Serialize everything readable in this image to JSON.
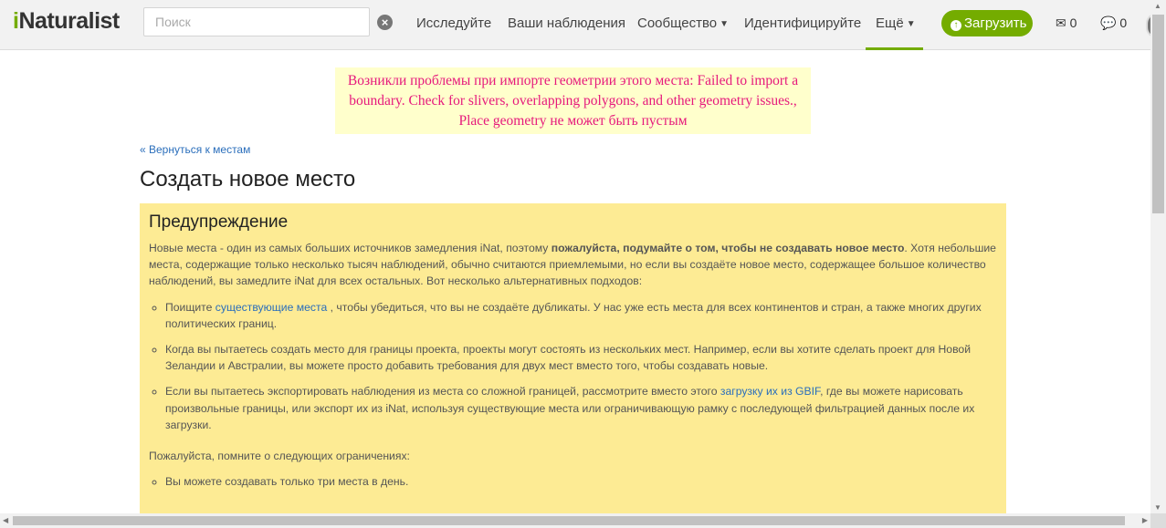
{
  "header": {
    "logo_prefix": "i",
    "logo_rest": "Naturalist",
    "search_placeholder": "Поиск",
    "clear_symbol": "×",
    "nav": {
      "explore": "Исследуйте",
      "your_observations": "Ваши наблюдения",
      "community": "Сообщество",
      "identify": "Идентифицируйте",
      "more": "Ещё"
    },
    "upload_label": "Загрузить",
    "messages_count": "0",
    "notifications_count": "0"
  },
  "error_notice": "Возникли проблемы при импорте геометрии этого места: Failed to import a boundary. Check for slivers, overlapping polygons, and other geometry issues., Place geometry не может быть пустым",
  "back_link": "« Вернуться к местам",
  "page_title": "Создать новое место",
  "warning": {
    "heading": "Предупреждение",
    "intro_1": "Новые места - один из самых больших источников замедления iNat, поэтому ",
    "intro_bold": "пожалуйста, подумайте о том, чтобы не создавать новое место",
    "intro_2": ". Хотя небольшие места, содержащие только несколько тысяч наблюдений, обычно считаются приемлемыми, но если вы создаёте новое место, содержащее большое количество наблюдений, вы замедлите iNat для всех остальных. Вот несколько альтернативных подходов:",
    "alt1_pre": "Поищите ",
    "alt1_link": "существующие места",
    "alt1_post": " , чтобы убедиться, что вы не создаёте дубликаты. У нас уже есть места для всех континентов и стран, а также многих других политических границ.",
    "alt2": "Когда вы пытаетесь создать место для границы проекта, проекты могут состоять из нескольких мест. Например, если вы хотите сделать проект для Новой Зеландии и Австралии, вы можете просто добавить требования для двух мест вместо того, чтобы создавать новые.",
    "alt3_pre": "Если вы пытаетесь экспортировать наблюдения из места со сложной границей, рассмотрите вместо этого ",
    "alt3_link": "загрузку их из GBIF",
    "alt3_post": ", где вы можете нарисовать произвольные границы, или экспорт их из iNat, используя существующие места или ограничивающую рамку с последующей фильтрацией данных после их загрузки.",
    "limits_intro": "Пожалуйста, помните о следующих ограничениях:",
    "limit1": "Вы можете создавать только три места в день."
  },
  "colors": {
    "brand_green": "#74ac00",
    "error_text": "#e6197c",
    "warning_bg": "#fdeb94",
    "link": "#2a6ebb"
  }
}
